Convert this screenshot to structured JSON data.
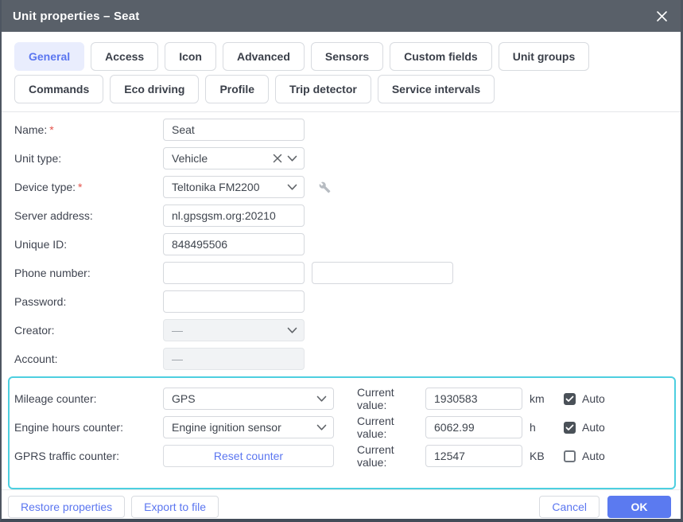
{
  "title_bar": {
    "title": "Unit properties – Seat"
  },
  "tabs": {
    "active": "General",
    "items": [
      "General",
      "Access",
      "Icon",
      "Advanced",
      "Sensors",
      "Custom fields",
      "Unit groups",
      "Commands",
      "Eco driving",
      "Profile",
      "Trip detector",
      "Service intervals"
    ]
  },
  "form": {
    "name": {
      "label": "Name:",
      "required": "*",
      "value": "Seat"
    },
    "unit_type": {
      "label": "Unit type:",
      "value": "Vehicle"
    },
    "device_type": {
      "label": "Device type:",
      "required": "*",
      "value": "Teltonika FM2200"
    },
    "server_address": {
      "label": "Server address:",
      "value": "nl.gpsgsm.org:20210"
    },
    "unique_id": {
      "label": "Unique ID:",
      "value": "848495506"
    },
    "phone_number": {
      "label": "Phone number:",
      "value1": "",
      "value2": ""
    },
    "password": {
      "label": "Password:",
      "value": ""
    },
    "creator": {
      "label": "Creator:",
      "value": "—"
    },
    "account": {
      "label": "Account:",
      "value": "—"
    }
  },
  "counters": {
    "mileage": {
      "label": "Mileage counter:",
      "source": "GPS",
      "current_label": "Current value:",
      "value": "1930583",
      "unit": "km",
      "auto_label": "Auto",
      "auto_checked": true
    },
    "engine_hours": {
      "label": "Engine hours counter:",
      "source": "Engine ignition sensor",
      "current_label": "Current value:",
      "value": "6062.99",
      "unit": "h",
      "auto_label": "Auto",
      "auto_checked": true
    },
    "gprs_traffic": {
      "label": "GPRS traffic counter:",
      "reset_button": "Reset counter",
      "current_label": "Current value:",
      "value": "12547",
      "unit": "KB",
      "auto_label": "Auto",
      "auto_checked": false
    }
  },
  "footer": {
    "restore_button": "Restore properties",
    "export_button": "Export to file",
    "cancel_button": "Cancel",
    "ok_button": "OK"
  },
  "colors": {
    "title_bar": "#596069",
    "accent_blue": "#5b76f0",
    "ok_blue": "#5b7af0",
    "active_tab_bg": "#e9edfd",
    "highlight_border": "#4dcfe0",
    "required_red": "#e5534b",
    "checkbox_checked": "#4a5158"
  }
}
